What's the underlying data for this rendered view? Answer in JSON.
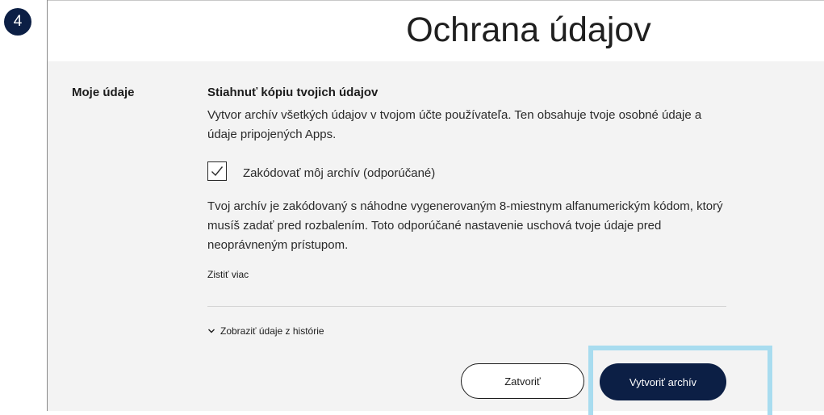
{
  "step_badge": "4",
  "page_title": "Ochrana údajov",
  "section_label": "Moje údaje",
  "download": {
    "title": "Stiahnuť kópiu tvojich údajov",
    "description": "Vytvor archív všetkých údajov v tvojom účte používateľa. Ten obsahuje tvoje osobné údaje a údaje pripojených Apps."
  },
  "encrypt": {
    "checked": true,
    "label": "Zakódovať môj archív (odporúčané)",
    "description": "Tvoj archív je zakódovaný s náhodne vygenerovaným 8-miestnym alfanumerickým kódom, ktorý musíš zadať pred rozbalením. Toto odporúčané nastavenie uschová tvoje údaje pred neoprávneným prístupom."
  },
  "learn_more_link": "Zistiť viac",
  "history_toggle": "Zobraziť údaje z histórie",
  "buttons": {
    "close": "Zatvoriť",
    "create_archive": "Vytvoriť archív"
  },
  "colors": {
    "primary": "#0c1f45",
    "highlight": "#a8dcef",
    "content_background": "#f3f3f3"
  },
  "icons": {
    "checkbox": "check-icon",
    "history_toggle": "chevron-down-icon"
  }
}
